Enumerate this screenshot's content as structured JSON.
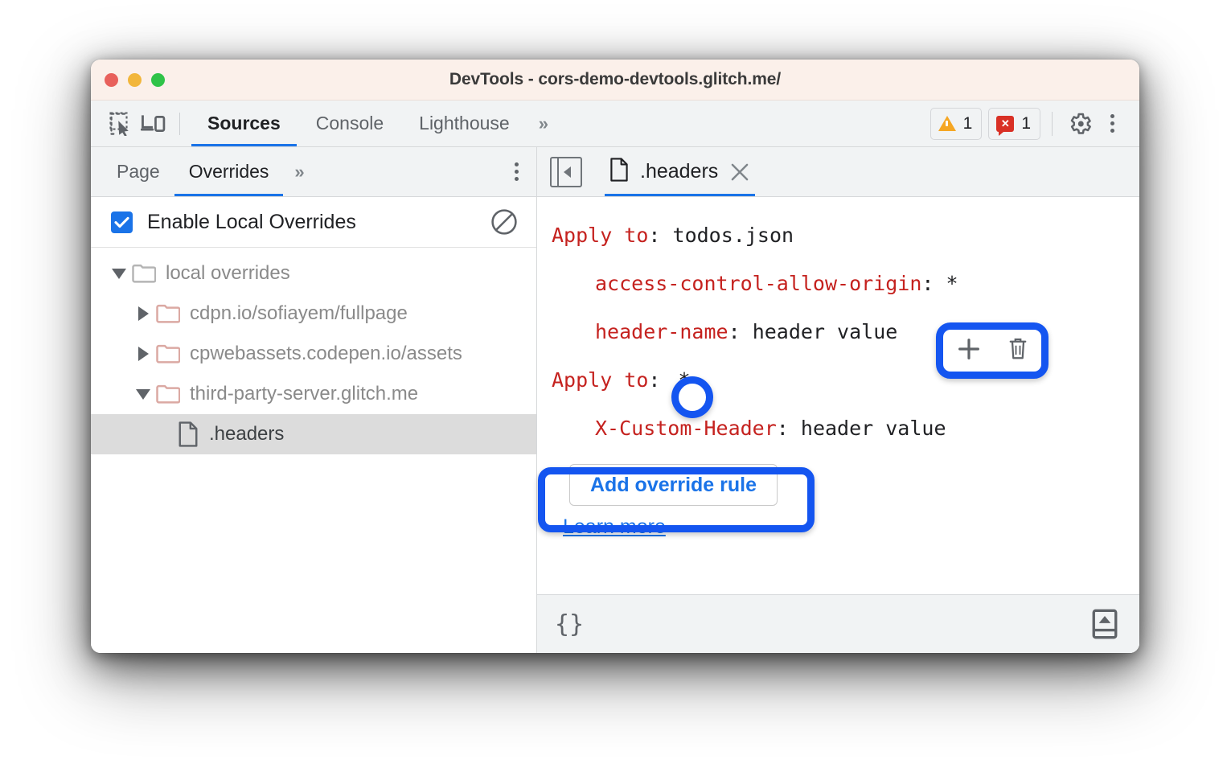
{
  "window": {
    "title": "DevTools - cors-demo-devtools.glitch.me/",
    "traffic_lights": [
      "close-red",
      "minimize-yellow",
      "zoom-green"
    ],
    "colors": {
      "titlebar_bg": "#fbf0ea",
      "accent_blue": "#1a73e8",
      "annotation_blue": "#1455f0",
      "header_key_red": "#c5221f",
      "warning_orange": "#f5a623",
      "error_red": "#d93025"
    }
  },
  "toolbar": {
    "inspect_icon": "inspect-element-icon",
    "device_icon": "device-toolbar-icon",
    "tabs": [
      {
        "label": "Sources",
        "active": true
      },
      {
        "label": "Console",
        "active": false
      },
      {
        "label": "Lighthouse",
        "active": false
      }
    ],
    "more_tabs": "»",
    "warning_count": "1",
    "error_count": "1",
    "settings_icon": "gear-icon",
    "menu_icon": "kebab-menu-icon"
  },
  "navigator": {
    "tabs": [
      {
        "label": "Page",
        "active": false
      },
      {
        "label": "Overrides",
        "active": true
      }
    ],
    "more_tabs": "»",
    "menu_icon": "kebab-menu-icon",
    "enable_overrides": {
      "label": "Enable Local Overrides",
      "checked": true,
      "clear_icon": "clear-configuration-icon"
    },
    "tree": [
      {
        "label": "local overrides",
        "depth": 0,
        "icon": "folder-icon",
        "expanded": true,
        "folder_color": "gray",
        "selected": false
      },
      {
        "label": "cdpn.io/sofiayem/fullpage",
        "depth": 1,
        "icon": "folder-icon",
        "expanded": false,
        "folder_color": "salmon",
        "selected": false
      },
      {
        "label": "cpwebassets.codepen.io/assets",
        "depth": 1,
        "icon": "folder-icon",
        "expanded": false,
        "folder_color": "salmon",
        "selected": false
      },
      {
        "label": "third-party-server.glitch.me",
        "depth": 1,
        "icon": "folder-icon",
        "expanded": true,
        "folder_color": "salmon",
        "selected": false
      },
      {
        "label": ".headers",
        "depth": 2,
        "icon": "file-icon",
        "expanded": null,
        "folder_color": null,
        "selected": true
      }
    ]
  },
  "editor": {
    "collapse_icon": "collapse-sidebar-icon",
    "tab": {
      "file_icon": "file-icon",
      "label": ".headers",
      "close_icon": "close-icon",
      "active": true
    },
    "header_rules": [
      {
        "type": "apply",
        "key": "Apply to",
        "value": "todos.json",
        "indent": false
      },
      {
        "type": "header",
        "key": "access-control-allow-origin",
        "value": "*",
        "indent": true
      },
      {
        "type": "header",
        "key": "header-name",
        "value": "header value",
        "indent": true
      },
      {
        "type": "apply",
        "key": "Apply to",
        "value": "*",
        "indent": false
      },
      {
        "type": "header",
        "key": "X-Custom-Header",
        "value": "header value",
        "indent": true
      }
    ],
    "row_actions": {
      "add_icon": "plus-icon",
      "delete_icon": "trash-icon"
    },
    "add_override_rule_label": "Add override rule",
    "learn_more_label": "Learn more"
  },
  "status_bar": {
    "format_label": "{}",
    "popout_icon": "show-drawer-icon"
  },
  "annotations": [
    {
      "name": "plus-delete-highlight",
      "shape": "rounded-rect"
    },
    {
      "name": "apply-to-wildcard-highlight",
      "shape": "circle"
    },
    {
      "name": "add-override-rule-highlight",
      "shape": "rounded-rect"
    }
  ]
}
